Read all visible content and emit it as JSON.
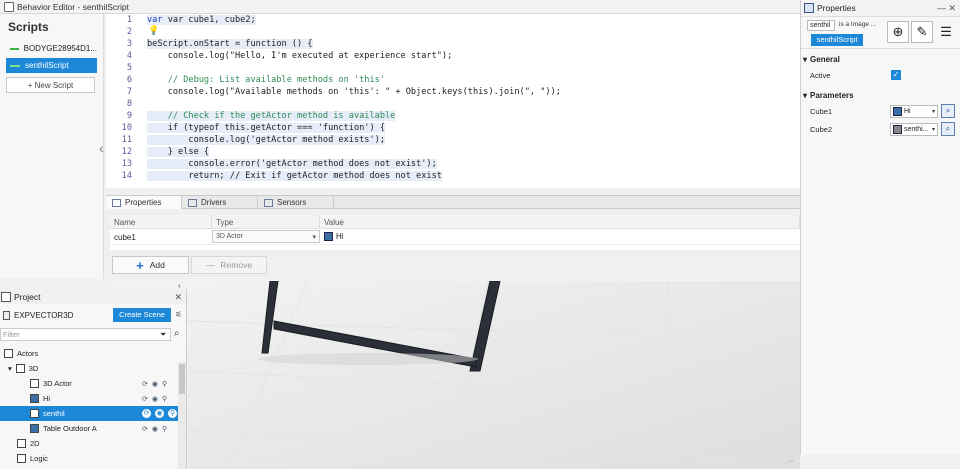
{
  "behavior_editor": {
    "title": "Behavior Editor - senthilScript",
    "scripts_heading": "Scripts",
    "scripts": [
      {
        "label": "BODYGE28954D1..."
      },
      {
        "label": "senthilScript"
      }
    ],
    "new_script_label": "+ New Script"
  },
  "code": {
    "line_numbers": [
      "1",
      "2",
      "3",
      "4",
      "5",
      "6",
      "7",
      "8",
      "9",
      "10",
      "11",
      "12",
      "13",
      "14"
    ],
    "lines": [
      "var cube1, cube2;",
      "",
      "beScript.onStart = function () {",
      "    console.log(\"Hello, I'm executed at experience start\");",
      "",
      "    // Debug: List available methods on 'this'",
      "    console.log(\"Available methods on 'this': \" + Object.keys(this).join(\", \"));",
      "",
      "    // Check if the getActor method is available",
      "    if (typeof this.getActor === 'function') {",
      "        console.log('getActor method exists');",
      "    } else {",
      "        console.error('getActor method does not exist');",
      "        return; // Exit if getActor method does not exist"
    ]
  },
  "tabs": [
    {
      "label": "Properties"
    },
    {
      "label": "Drivers"
    },
    {
      "label": "Sensors"
    }
  ],
  "params_table": {
    "columns": [
      "Name",
      "Type",
      "Value"
    ],
    "rows": [
      {
        "name": "cube1",
        "type": "3D Actor",
        "value": "Hi"
      }
    ]
  },
  "buttons": {
    "add": "Add",
    "remove": "Remove"
  },
  "properties_panel": {
    "title": "Properties",
    "name_field": "senthil",
    "type_text": "is a Image ...",
    "script_tag": "senthilScript",
    "sections": {
      "general": "General",
      "parameters": "Parameters"
    },
    "active_label": "Active",
    "active_checked": true,
    "params": [
      {
        "label": "Cube1",
        "value": "Hi"
      },
      {
        "label": "Cube2",
        "value": "senthi..."
      }
    ]
  },
  "project": {
    "title": "Project",
    "name": "EXPVECTOR3D",
    "create_scene": "Create Scene",
    "filter_placeholder": "Filter",
    "tree": [
      {
        "label": "Actors",
        "indent": 0
      },
      {
        "label": "3D",
        "indent": 1
      },
      {
        "label": "3D Actor",
        "indent": 2
      },
      {
        "label": "Hi",
        "indent": 2
      },
      {
        "label": "senthil",
        "indent": 2,
        "selected": true
      },
      {
        "label": "Table Outdoor A",
        "indent": 2
      },
      {
        "label": "2D",
        "indent": 1
      },
      {
        "label": "Logic",
        "indent": 1
      }
    ]
  },
  "colors": {
    "accent": "#1e88d8",
    "keyword": "#1a3fc2",
    "string": "#a31515",
    "comment": "#2e8b57"
  }
}
